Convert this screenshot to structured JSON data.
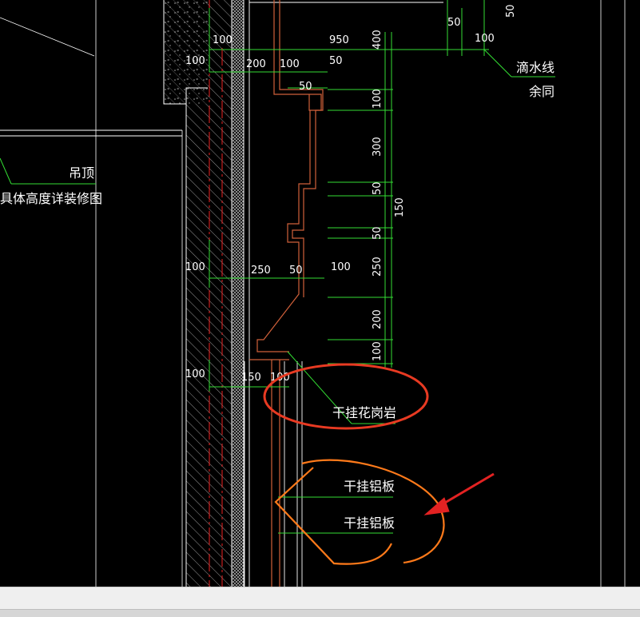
{
  "drawing": {
    "dims_h": {
      "top_950": "950",
      "top_50": "50",
      "top_100": "100",
      "r1_100": "100",
      "r2_200": "200",
      "r2_100": "100",
      "r2_50": "50",
      "r3_50": "50",
      "m_250": "250",
      "m_50": "50",
      "m_100": "100",
      "b_150": "150",
      "b_100": "100"
    },
    "dims_left": {
      "l1": "100",
      "l2": "100",
      "l3": "100"
    },
    "dims_v": {
      "top_50": "50",
      "v_400": "400",
      "v_100a": "100",
      "v_300": "300",
      "v_50a": "50",
      "v_50b": "50",
      "v_250": "250",
      "v_200": "200",
      "v_100b": "100",
      "v_150": "150"
    },
    "labels": {
      "drip_line": "滴水线",
      "same_rest": "余同",
      "ceiling": "吊顶",
      "ceiling_detail": "具体高度详装修图",
      "granite": "干挂花岗岩",
      "aluminum_1": "干挂铝板",
      "aluminum_2": "干挂铝板"
    },
    "colors": {
      "background": "#000000",
      "dimension_line": "#33dd33",
      "wall_line": "#ffffff",
      "centerline": "#ee2222",
      "profile": "#d0603a",
      "markup": "#e83a22",
      "markup_orange": "#ff7a1a",
      "arrow": "#e32222"
    }
  }
}
